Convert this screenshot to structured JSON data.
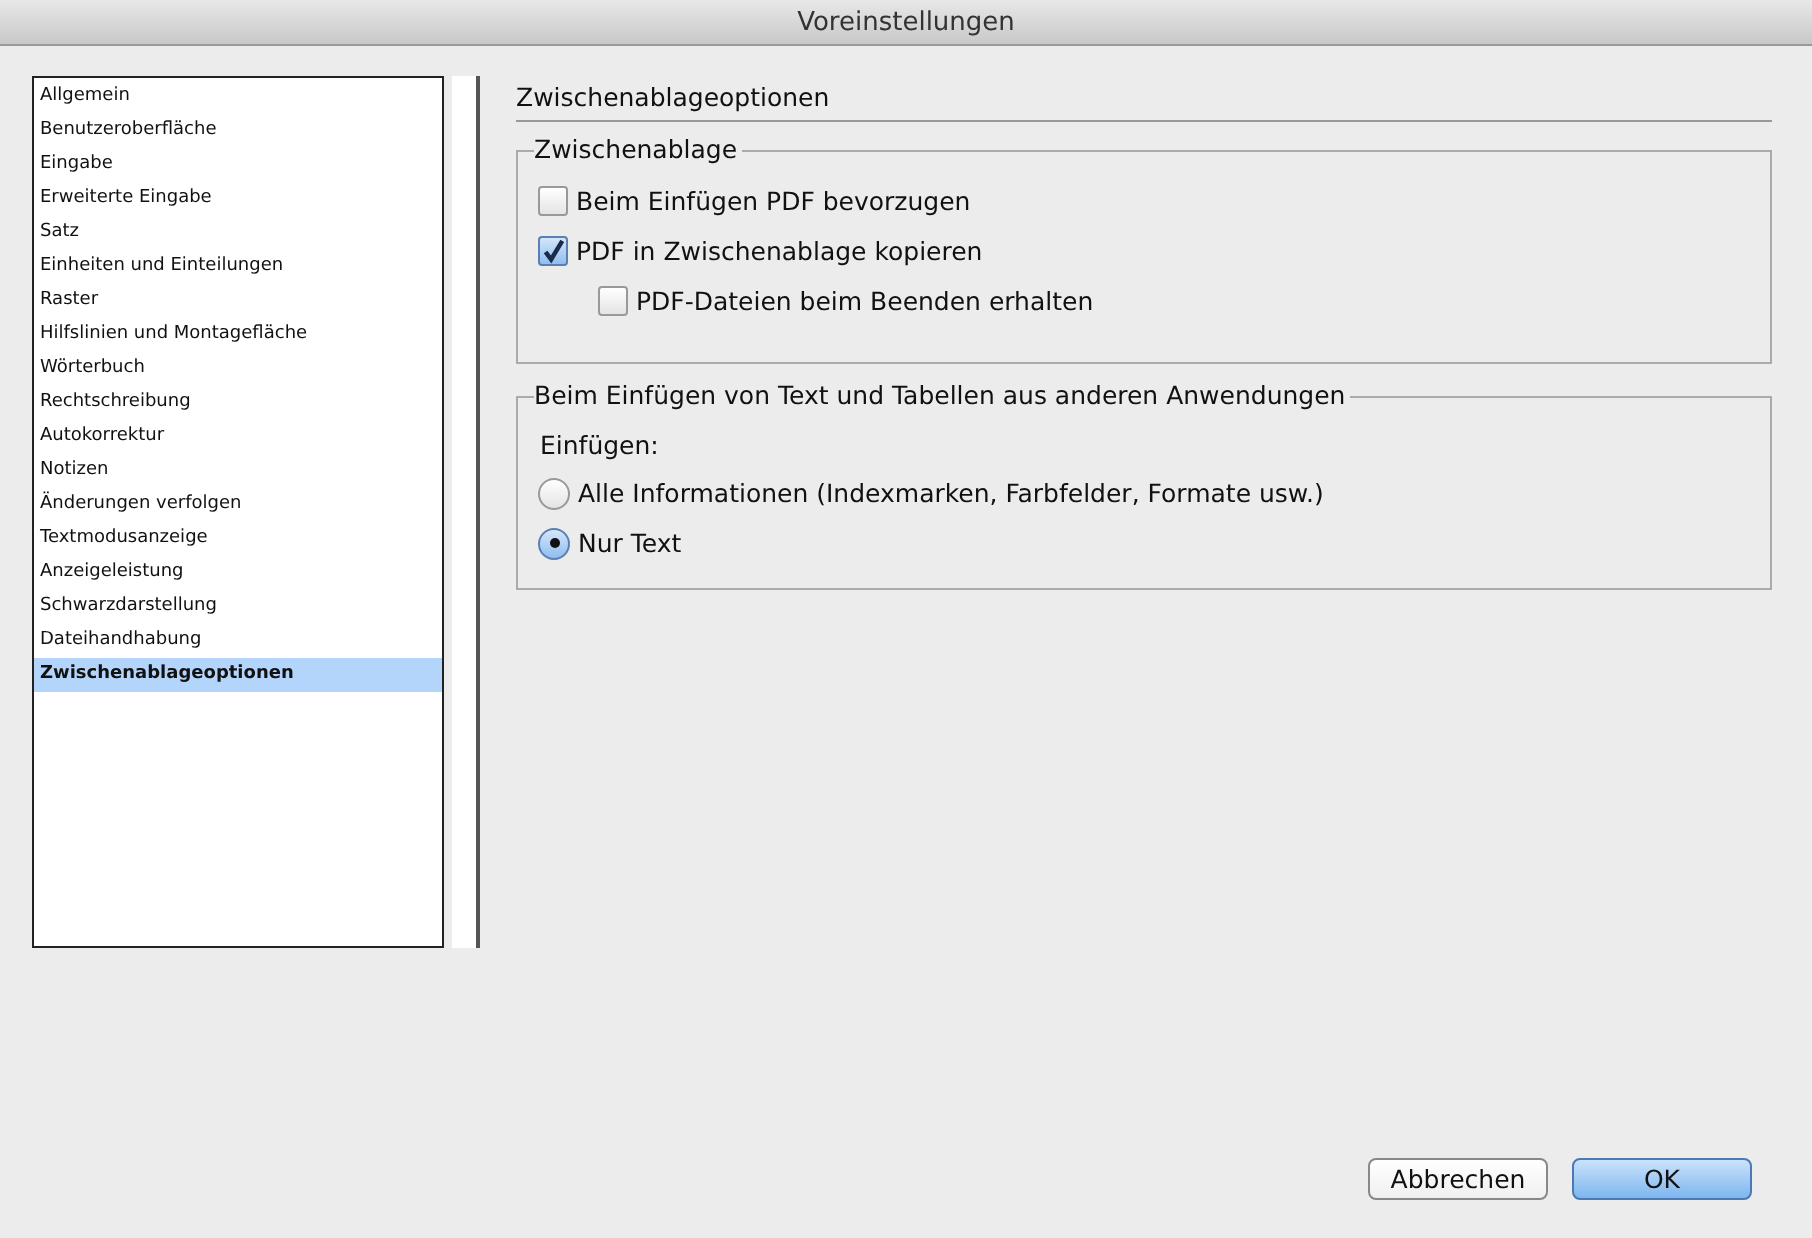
{
  "window": {
    "title": "Voreinstellungen"
  },
  "sidebar": {
    "items": [
      {
        "label": "Allgemein",
        "selected": false
      },
      {
        "label": "Benutzeroberfläche",
        "selected": false
      },
      {
        "label": "Eingabe",
        "selected": false
      },
      {
        "label": "Erweiterte Eingabe",
        "selected": false
      },
      {
        "label": "Satz",
        "selected": false
      },
      {
        "label": "Einheiten und Einteilungen",
        "selected": false
      },
      {
        "label": "Raster",
        "selected": false
      },
      {
        "label": "Hilfslinien und Montagefläche",
        "selected": false
      },
      {
        "label": "Wörterbuch",
        "selected": false
      },
      {
        "label": "Rechtschreibung",
        "selected": false
      },
      {
        "label": "Autokorrektur",
        "selected": false
      },
      {
        "label": "Notizen",
        "selected": false
      },
      {
        "label": "Änderungen verfolgen",
        "selected": false
      },
      {
        "label": "Textmodusanzeige",
        "selected": false
      },
      {
        "label": "Anzeigeleistung",
        "selected": false
      },
      {
        "label": "Schwarzdarstellung",
        "selected": false
      },
      {
        "label": "Dateihandhabung",
        "selected": false
      },
      {
        "label": "Zwischenablageoptionen",
        "selected": true
      }
    ]
  },
  "panel": {
    "title": "Zwischenablageoptionen",
    "groups": [
      {
        "title": "Zwischenablage",
        "options": [
          {
            "kind": "checkbox",
            "label": "Beim Einfügen PDF bevorzugen",
            "checked": false
          },
          {
            "kind": "checkbox",
            "label": "PDF in Zwischenablage kopieren",
            "checked": true,
            "children": [
              {
                "kind": "checkbox",
                "label": "PDF-Dateien beim Beenden erhalten",
                "checked": false
              }
            ]
          }
        ]
      },
      {
        "title": "Beim Einfügen von Text und Tabellen aus anderen Anwendungen",
        "caption": "Einfügen:",
        "options": [
          {
            "kind": "radio",
            "label": "Alle Informationen (Indexmarken, Farbfelder, Formate usw.)",
            "selected": false
          },
          {
            "kind": "radio",
            "label": "Nur Text",
            "selected": true
          }
        ]
      }
    ]
  },
  "buttons": [
    {
      "label": "Abbrechen",
      "default": false
    },
    {
      "label": "OK",
      "default": true
    }
  ]
}
